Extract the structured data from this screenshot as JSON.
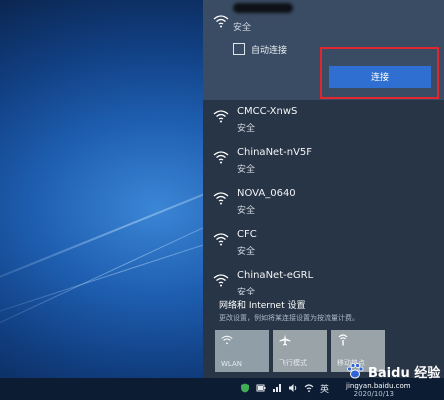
{
  "colors": {
    "panel_bg": "#283546",
    "selected_bg": "#3a4c63",
    "connect_button": "#2f6fd1",
    "highlight_border": "#e3262e",
    "quick_tile": "#9aa3a8"
  },
  "selected_network": {
    "status": "安全",
    "auto_connect_label": "自动连接",
    "auto_connect_checked": false,
    "connect_label": "连接",
    "icon": "wifi-icon"
  },
  "networks": [
    {
      "name": "CMCC-XnwS",
      "status": "安全",
      "icon": "wifi-icon"
    },
    {
      "name": "ChinaNet-nV5F",
      "status": "安全",
      "icon": "wifi-icon"
    },
    {
      "name": "NOVA_0640",
      "status": "安全",
      "icon": "wifi-icon"
    },
    {
      "name": "CFC",
      "status": "安全",
      "icon": "wifi-icon"
    },
    {
      "name": "ChinaNet-eGRL",
      "status": "安全",
      "icon": "wifi-icon"
    }
  ],
  "settings": {
    "title": "网络和 Internet 设置",
    "description": "更改设置，例如将某连接设置为按流量计费。"
  },
  "quick_actions": [
    {
      "label": "WLAN",
      "icon": "wifi-icon"
    },
    {
      "label": "飞行模式",
      "icon": "airplane-icon"
    },
    {
      "label": "移动热点",
      "icon": "hotspot-icon"
    }
  ],
  "taskbar": {
    "input_language": "英",
    "date": "2020/10/13",
    "tray_icons": [
      "shield-icon",
      "battery-icon",
      "network-icon",
      "volume-icon"
    ]
  },
  "watermark": {
    "logo_text": "Baidu 经验",
    "url": "jingyan.baidu.com"
  }
}
